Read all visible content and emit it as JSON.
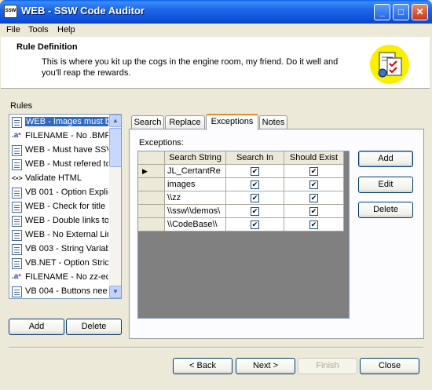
{
  "window": {
    "title": "WEB - SSW Code Auditor",
    "app_icon_text": "SSW"
  },
  "titlebar_buttons": {
    "minimize": "_",
    "maximize": "□",
    "close": "✕"
  },
  "menu": [
    {
      "label": "File"
    },
    {
      "label": "Tools"
    },
    {
      "label": "Help"
    }
  ],
  "header": {
    "title": "Rule Definition",
    "description": "This is where you kit up the cogs in the engine room, my friend. Do it well and you'll reap the rewards."
  },
  "rules": {
    "label": "Rules",
    "items": [
      {
        "label": "WEB - Images must be",
        "icon": "document-icon"
      },
      {
        "label": "FILENAME - No .BMP",
        "icon": "filename-icon"
      },
      {
        "label": "WEB - Must have SSV",
        "icon": "document-icon"
      },
      {
        "label": "WEB - Must refered to",
        "icon": "document-icon"
      },
      {
        "label": "Validate HTML",
        "icon": "html-icon"
      },
      {
        "label": "VB 001 - Option Explic",
        "icon": "document-icon"
      },
      {
        "label": "WEB - Check for title",
        "icon": "document-icon"
      },
      {
        "label": "WEB - Double links to",
        "icon": "document-icon"
      },
      {
        "label": "WEB - No External Lin",
        "icon": "document-icon"
      },
      {
        "label": "VB 003 - String Variab",
        "icon": "document-icon"
      },
      {
        "label": "VB.NET - Option Stric",
        "icon": "document-icon"
      },
      {
        "label": "FILENAME - No zz-ec",
        "icon": "filename-icon"
      },
      {
        "label": "VB 004 - Buttons nee",
        "icon": "document-icon"
      }
    ],
    "add_label": "Add",
    "delete_label": "Delete"
  },
  "tabs": [
    {
      "label": "Search"
    },
    {
      "label": "Replace"
    },
    {
      "label": "Exceptions"
    },
    {
      "label": "Notes"
    }
  ],
  "exceptions": {
    "label": "Exceptions:",
    "columns": [
      "Search String",
      "Search In",
      "Should Exist"
    ],
    "rows": [
      {
        "search_string": "JL_CertantRe",
        "search_in": true,
        "should_exist": true
      },
      {
        "search_string": "images",
        "search_in": true,
        "should_exist": true
      },
      {
        "search_string": "\\\\zz",
        "search_in": true,
        "should_exist": true
      },
      {
        "search_string": "\\\\ssw\\\\demos\\",
        "search_in": true,
        "should_exist": true
      },
      {
        "search_string": "\\\\CodeBase\\\\",
        "search_in": true,
        "should_exist": true
      }
    ],
    "add_label": "Add",
    "edit_label": "Edit",
    "delete_label": "Delete"
  },
  "footer": {
    "back_label": "< Back",
    "next_label": "Next >",
    "finish_label": "Finish",
    "close_label": "Close"
  }
}
